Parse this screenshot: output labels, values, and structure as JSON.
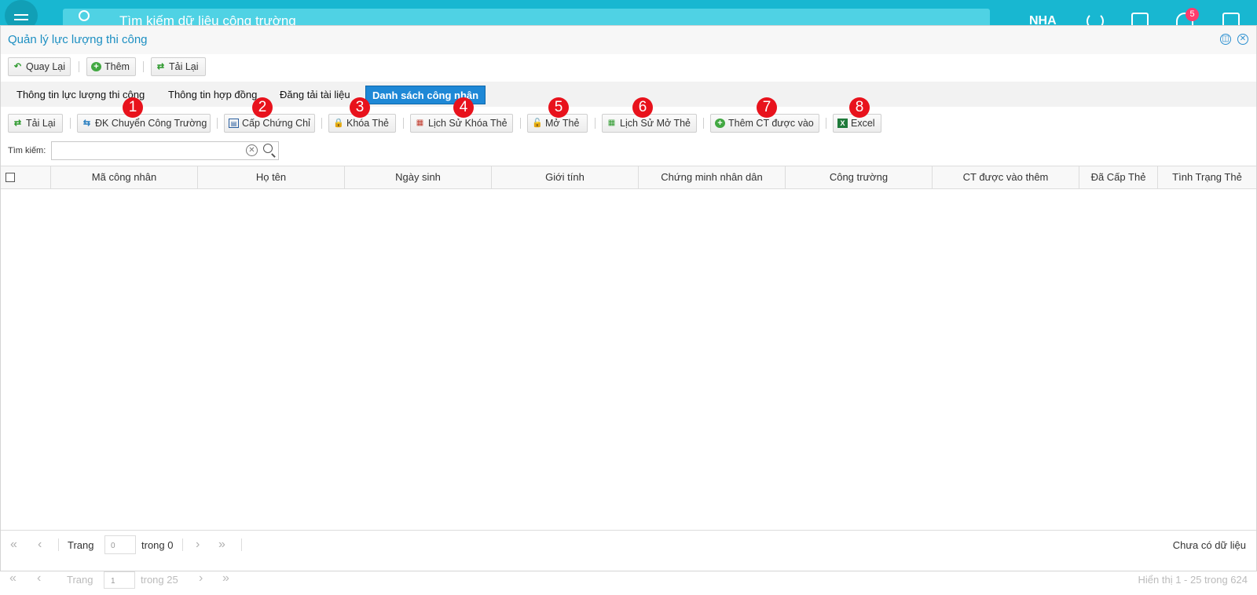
{
  "app": {
    "search_placeholder": "Tìm kiếm dữ liệu công trường",
    "user_abbr": "NHA",
    "notification_count": "5"
  },
  "dialog": {
    "title": "Quản lý lực lượng thi công",
    "top_toolbar": {
      "back": "Quay Lại",
      "add": "Thêm",
      "reload": "Tải Lại"
    },
    "tabs": [
      "Thông tin lực lượng thi công",
      "Thông tin hợp đồng",
      "Đăng tải tài liệu",
      "Danh sách công nhân"
    ],
    "active_tab": "Danh sách công nhân",
    "sub_toolbar": {
      "reload": "Tải Lại",
      "transfer": "ĐK Chuyển Công Trường",
      "certificate": "Cấp Chứng Chỉ",
      "lock_card": "Khóa Thẻ",
      "lock_history": "Lịch Sử Khóa Thẻ",
      "unlock_card": "Mở Thẻ",
      "unlock_history": "Lịch Sử Mở Thẻ",
      "add_site": "Thêm CT được vào",
      "excel": "Excel"
    },
    "markers": [
      "1",
      "2",
      "3",
      "4",
      "5",
      "6",
      "7",
      "8"
    ],
    "search": {
      "label": "Tìm kiếm:",
      "value": ""
    },
    "columns": [
      "Mã công nhân",
      "Họ tên",
      "Ngày sinh",
      "Giới tính",
      "Chứng minh nhân dân",
      "Công trường",
      "CT được vào thêm",
      "Đã Cấp Thẻ",
      "Tình Trạng Thẻ"
    ],
    "rows": [],
    "pager": {
      "page_label": "Trang",
      "page_value": "0",
      "of_label": "trong 0",
      "status": "Chưa có dữ liệu"
    }
  },
  "background_pager": {
    "page_label": "Trang",
    "page_value": "1",
    "of_label": "trong 25",
    "status": "Hiển thị 1 - 25 trong 624"
  },
  "colors": {
    "app_bar": "#18b7d1",
    "title": "#1c8fc2",
    "active_tab": "#1e88d6",
    "marker": "#e8121c",
    "badge": "#ff3b6c"
  }
}
